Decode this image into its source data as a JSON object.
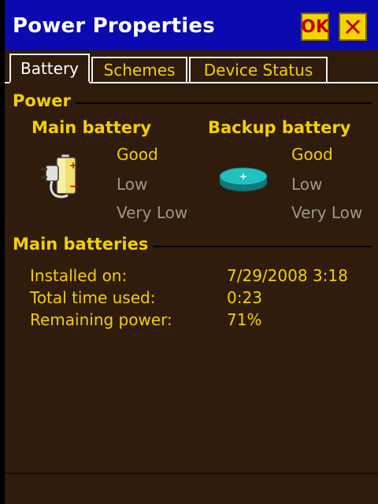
{
  "window": {
    "title": "Power Properties",
    "ok_label": "OK"
  },
  "tabs": [
    {
      "label": "Battery",
      "selected": true
    },
    {
      "label": "Schemes",
      "selected": false
    },
    {
      "label": "Device Status",
      "selected": false
    }
  ],
  "power_section": {
    "heading": "Power",
    "main_battery": {
      "title": "Main battery",
      "icon": "battery-plug-icon",
      "levels": [
        "Good",
        "Low",
        "Very Low"
      ],
      "active_level": "Good"
    },
    "backup_battery": {
      "title": "Backup battery",
      "icon": "coin-cell-battery-icon",
      "levels": [
        "Good",
        "Low",
        "Very Low"
      ],
      "active_level": "Good"
    }
  },
  "main_batteries_section": {
    "heading": "Main batteries",
    "rows": [
      {
        "label": "Installed on:",
        "value": "7/29/2008 3:18"
      },
      {
        "label": "Total time used:",
        "value": "0:23"
      },
      {
        "label": "Remaining power:",
        "value": "71%"
      }
    ]
  },
  "colors": {
    "title_bar": "#0a0ab0",
    "background": "#2f1c0c",
    "accent_text": "#f2d000",
    "disabled_text": "#9a9a8a",
    "button_face": "#f2d500"
  }
}
